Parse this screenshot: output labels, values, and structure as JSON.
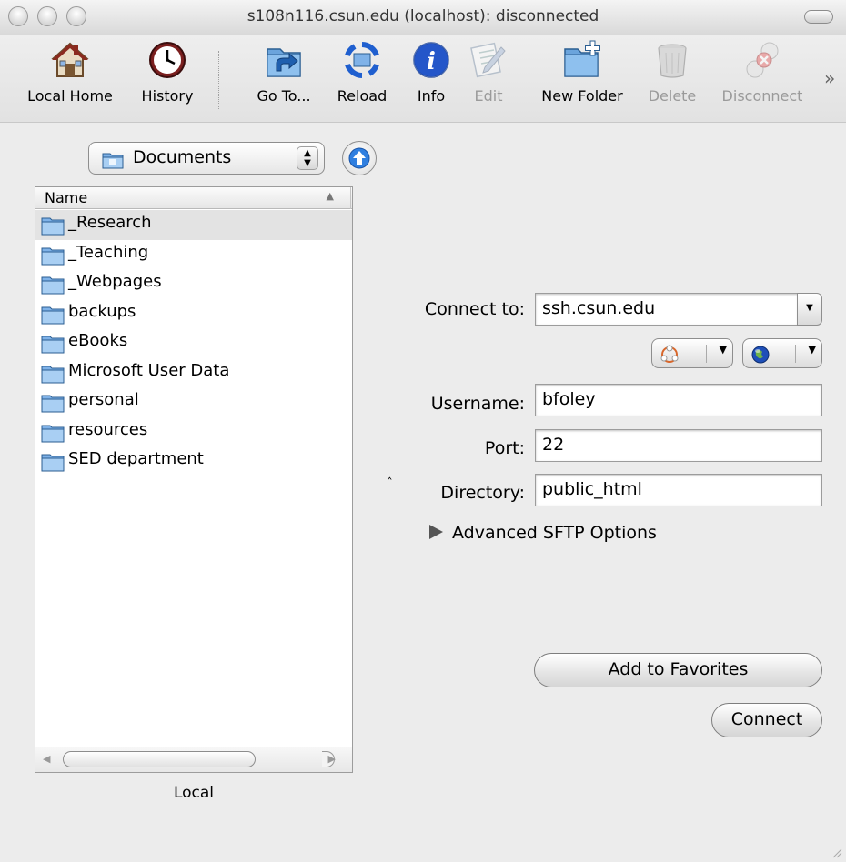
{
  "window": {
    "title": "s108n116.csun.edu (localhost): disconnected"
  },
  "toolbar": {
    "items": [
      {
        "label": "Local Home",
        "icon": "house-icon",
        "enabled": true
      },
      {
        "label": "History",
        "icon": "clock-icon",
        "enabled": true
      },
      {
        "label": "Go To...",
        "icon": "goto-folder-icon",
        "enabled": true
      },
      {
        "label": "Reload",
        "icon": "reload-icon",
        "enabled": true
      },
      {
        "label": "Info",
        "icon": "info-icon",
        "enabled": true
      },
      {
        "label": "Edit",
        "icon": "edit-icon",
        "enabled": false
      },
      {
        "label": "New Folder",
        "icon": "new-folder-icon",
        "enabled": true
      },
      {
        "label": "Delete",
        "icon": "trash-icon",
        "enabled": false
      },
      {
        "label": "Disconnect",
        "icon": "disconnect-icon",
        "enabled": false
      }
    ],
    "overflow": "»"
  },
  "local": {
    "location": "Documents",
    "column_header": "Name",
    "files": [
      "_Research",
      "_Teaching",
      "_Webpages",
      "backups",
      "eBooks",
      "Microsoft User Data",
      "personal",
      "resources",
      "SED department"
    ],
    "selected_index": 0,
    "pane_label": "Local"
  },
  "connect_form": {
    "connect_to_label": "Connect to:",
    "connect_to_value": "ssh.csun.edu",
    "username_label": "Username:",
    "username_value": "bfoley",
    "port_label": "Port:",
    "port_value": "22",
    "directory_label": "Directory:",
    "directory_value": "public_html",
    "advanced_label": "Advanced SFTP Options",
    "add_favorites_label": "Add to Favorites",
    "connect_label": "Connect"
  },
  "splitter_glyph": "‸",
  "colors": {
    "accent_blue": "#1f6fd6",
    "selection": "#e3e3e3",
    "disabled_text": "#9a9a9a"
  }
}
